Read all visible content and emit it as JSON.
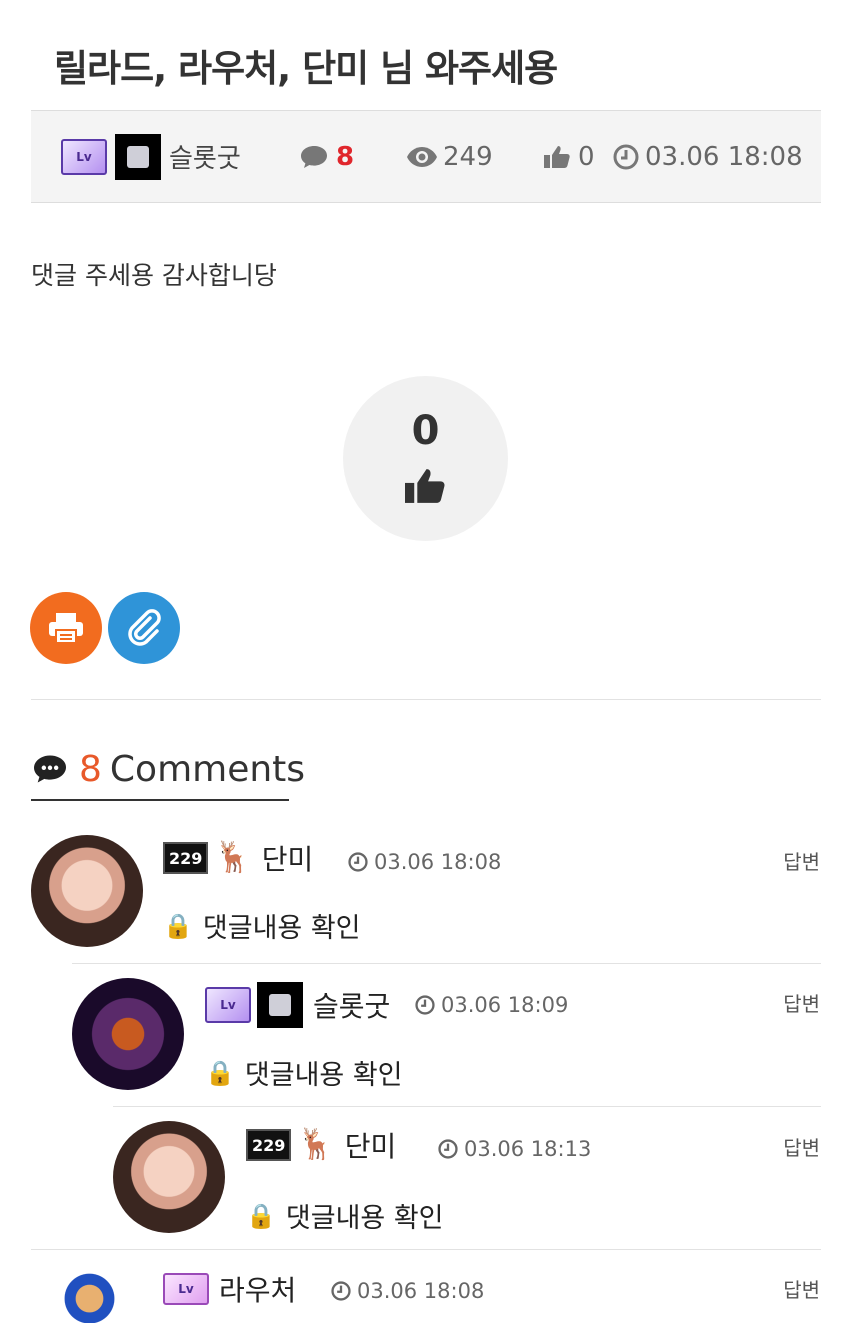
{
  "post": {
    "title": "릴라드, 라우처, 단미 님 와주세용",
    "author": "슬롯굿",
    "comment_count": "8",
    "views": "249",
    "likes": "0",
    "date": "03.06 18:08",
    "body": "댓글 주세용 감사합니당",
    "like_total": "0"
  },
  "comments_section": {
    "count": "8",
    "label": "Comments"
  },
  "comments": [
    {
      "name": "단미",
      "level_tag": "229",
      "date": "03.06 18:08",
      "text": "댓글내용 확인",
      "reply": "답변"
    },
    {
      "name": "슬롯굿",
      "level_tag": "",
      "date": "03.06 18:09",
      "text": "댓글내용 확인",
      "reply": "답변"
    },
    {
      "name": "단미",
      "level_tag": "229",
      "date": "03.06 18:13",
      "text": "댓글내용 확인",
      "reply": "답변"
    },
    {
      "name": "라우처",
      "level_tag": "",
      "date": "03.06 18:08",
      "text": "",
      "reply": "답변"
    }
  ],
  "colors": {
    "accent_red": "#e0262c",
    "comment_orange": "#e8592a",
    "print_orange": "#f26c1f",
    "link_blue": "#2f94d8"
  },
  "icons": [
    "chat-icon",
    "eye-icon",
    "thumbs-up-icon",
    "clock-icon",
    "print-icon",
    "paperclip-icon",
    "lock-icon"
  ]
}
